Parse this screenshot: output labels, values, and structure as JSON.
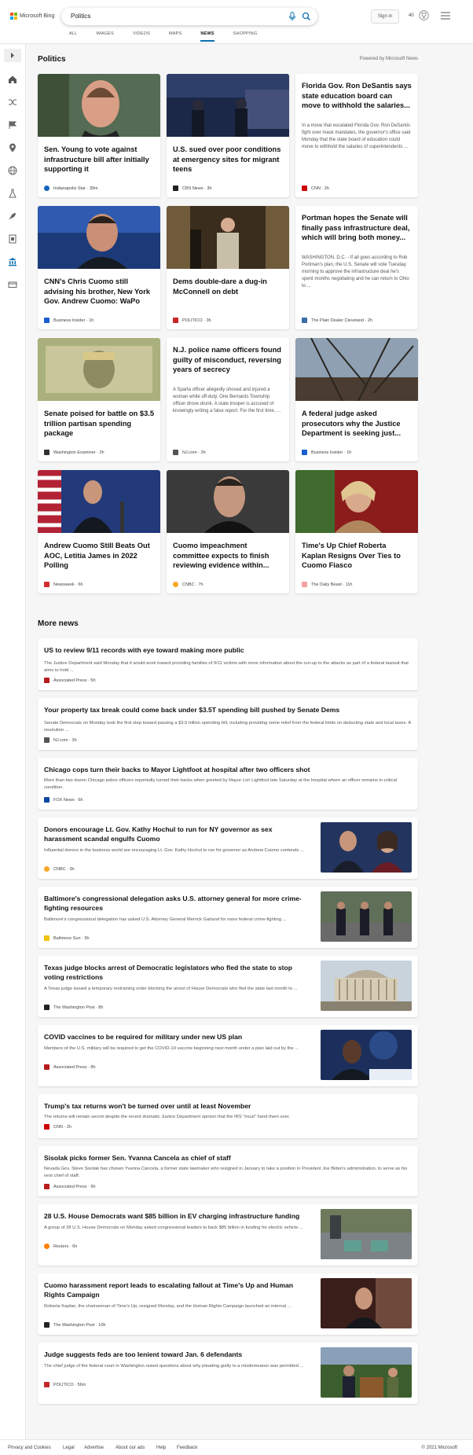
{
  "header": {
    "brand": "Microsoft Bing",
    "search_value": "Politics",
    "signin_label": "Sign in",
    "points": "40",
    "tabs": [
      "ALL",
      "IMAGES",
      "VIDEOS",
      "MAPS",
      "NEWS",
      "SHOPPING"
    ],
    "active_tab": "NEWS"
  },
  "section": {
    "title": "Politics",
    "powered_by": "Powered by Microsoft News"
  },
  "cards": [
    {
      "title": "Sen. Young to vote against infrastructure bill after initially supporting it",
      "snippet": "",
      "source": "Indianapolis Star",
      "time": "39m",
      "source_color": "#1565c0"
    },
    {
      "title": "U.S. sued over poor conditions at emergency sites for migrant teens",
      "snippet": "",
      "source": "CBS News",
      "time": "3h",
      "source_color": "#222222"
    },
    {
      "title": "Florida Gov. Ron DeSantis says state education board can move to withhold the salaries...",
      "snippet": "In a move that escalated Florida Gov. Ron DeSantis fight over mask mandates, the governor's office said Monday that the state board of education could move to withhold the salaries of superintendents ...",
      "source": "CNN",
      "time": "2h",
      "source_color": "#cc0000"
    },
    {
      "title": "CNN's Chris Cuomo still advising his brother, New York Gov. Andrew Cuomo: WaPo",
      "snippet": "",
      "source": "Business Insider",
      "time": "1h",
      "source_color": "#1a5fd0"
    },
    {
      "title": "Dems double-dare a dug-in McConnell on debt",
      "snippet": "",
      "source": "POLITICO",
      "time": "3h",
      "source_color": "#c62828"
    },
    {
      "title": "Portman hopes the Senate will finally pass infrastructure deal, which will bring both money...",
      "snippet": "WASHINGTON, D.C. - If all goes according to Rob Portman's plan, the U.S. Senate will vote Tuesday morning to approve the infrastructure deal he's spent months negotiating and he can return to Ohio to ...",
      "source": "The Plain Dealer Cleveland",
      "time": "2h",
      "source_color": "#3a6ea5"
    },
    {
      "title": "Senate poised for battle on $3.5 trillion partisan spending package",
      "snippet": "",
      "source": "Washington Examiner",
      "time": "2h",
      "source_color": "#333333"
    },
    {
      "title": "N.J. police name officers found guilty of misconduct, reversing years of secrecy",
      "snippet": "A Sparta officer allegedly shoved and injured a woman while off-duty. One Bernards Township officer drove drunk. A state trooper is accused of knowingly writing a false report. For the first time, ...",
      "source": "NJ.com",
      "time": "3h",
      "source_color": "#555555"
    },
    {
      "title": "A federal judge asked prosecutors why the Justice Department is seeking just...",
      "snippet": "",
      "source": "Business Insider",
      "time": "1h",
      "source_color": "#1a5fd0"
    },
    {
      "title": "Andrew Cuomo Still Beats Out AOC, Letitia James in 2022 Polling",
      "snippet": "",
      "source": "Newsweek",
      "time": "6h",
      "source_color": "#d32f2f"
    },
    {
      "title": "Cuomo impeachment committee expects to finish reviewing evidence within...",
      "snippet": "",
      "source": "CNBC",
      "time": "7h",
      "source_color": "#f9a825"
    },
    {
      "title": "Time's Up Chief Roberta Kaplan Resigns Over Ties to Cuomo Fiasco",
      "snippet": "",
      "source": "The Daily Beast",
      "time": "11h",
      "source_color": "#f4a0a0"
    }
  ],
  "more_news": {
    "title": "More news",
    "items": [
      {
        "title": "US to review 9/11 records with eye toward making more public",
        "snippet": "The Justice Department said Monday that it would work toward providing families of 9/11 victims with more information about the run-up to the attacks as part of a federal lawsuit that aims to hold ...",
        "source": "Associated Press",
        "time": "5h",
        "source_color": "#b71c1c",
        "has_thumb": false
      },
      {
        "title": "Your property tax break could come back under $3.5T spending bill pushed by Senate Dems",
        "snippet": "Senate Democrats on Monday took the first step toward passing a $3.5 trillion spending bill, including providing some relief from the federal limits on deducting state and local taxes. A resolution ...",
        "source": "NJ.com",
        "time": "3h",
        "source_color": "#555555",
        "has_thumb": false
      },
      {
        "title": "Chicago cops turn their backs to Mayor Lightfoot at hospital after two officers shot",
        "snippet": "More than two dozen Chicago police officers reportedly turned their backs when greeted by Mayor Lori Lightfoot late Saturday at the hospital where an officer remains in critical condition.",
        "source": "FOX News",
        "time": "6h",
        "source_color": "#0d47a1",
        "has_thumb": false
      },
      {
        "title": "Donors encourage Lt. Gov. Kathy Hochul to run for NY governor as sex harassment scandal engulfs Cuomo",
        "snippet": "Influential donors in the business world are encouraging Lt. Gov. Kathy Hochul to run for governor as Andrew Cuomo contends ...",
        "source": "CNBC",
        "time": "3h",
        "source_color": "#f9a825",
        "has_thumb": true
      },
      {
        "title": "Baltimore's congressional delegation asks U.S. attorney general for more crime-fighting resources",
        "snippet": "Baltimore's congressional delegation has asked U.S. Attorney General Merrick Garland for more federal crime-fighting ...",
        "source": "Baltimore Sun",
        "time": "5h",
        "source_color": "#f2c200",
        "has_thumb": true
      },
      {
        "title": "Texas judge blocks arrest of Democratic legislators who fled the state to stop voting restrictions",
        "snippet": "A Texas judge issued a temporary restraining order blocking the arrest of House Democrats who fled the state last month to ...",
        "source": "The Washington Post",
        "time": "8h",
        "source_color": "#222222",
        "has_thumb": true
      },
      {
        "title": "COVID vaccines to be required for military under new US plan",
        "snippet": "Members of the U.S. military will be required to get the COVID-19 vaccine beginning next month under a plan laid out by the ...",
        "source": "Associated Press",
        "time": "8h",
        "source_color": "#b71c1c",
        "has_thumb": true
      },
      {
        "title": "Trump's tax returns won't be turned over until at least November",
        "snippet": "The returns will remain secret despite the recent dramatic Justice Department opinion that the IRS \"must\" hand them over.",
        "source": "CNN",
        "time": "2h",
        "source_color": "#cc0000",
        "has_thumb": false
      },
      {
        "title": "Sisolak picks former Sen. Yvanna Cancela as chief of staff",
        "snippet": "Nevada Gov. Steve Sisolak has chosen Yvanna Cancela, a former state lawmaker who resigned in January to take a position in President Joe Biden's administration, to serve as his next chief of staff.",
        "source": "Associated Press",
        "time": "9h",
        "source_color": "#b71c1c",
        "has_thumb": false
      },
      {
        "title": "28 U.S. House Democrats want $85 billion in EV charging infrastructure funding",
        "snippet": "A group of 28 U.S. House Democrats on Monday asked congressional leaders to back $85 billion in funding for electric vehicle ...",
        "source": "Reuters",
        "time": "6h",
        "source_color": "#ff8000",
        "has_thumb": true
      },
      {
        "title": "Cuomo harassment report leads to escalating fallout at Time's Up and Human Rights Campaign",
        "snippet": "Roberta Kaplan, the chairwoman of Time's Up, resigned Monday, and the Human Rights Campaign launched an internal ...",
        "source": "The Washington Post",
        "time": "10h",
        "source_color": "#222222",
        "has_thumb": true
      },
      {
        "title": "Judge suggests feds are too lenient toward Jan. 6 defendants",
        "snippet": "The chief judge of the federal court in Washington raised questions about why pleading guilty to a misdemeanor was permitted ...",
        "source": "POLITICO",
        "time": "56m",
        "source_color": "#c62828",
        "has_thumb": true
      }
    ]
  },
  "footer": {
    "links": [
      "Privacy and Cookies",
      "Legal",
      "Advertise",
      "About our ads",
      "Help",
      "Feedback"
    ],
    "copyright": "© 2021 Microsoft"
  },
  "colors": {
    "accent": "#0b6fb0",
    "page_bg": "#f6f6f6"
  }
}
